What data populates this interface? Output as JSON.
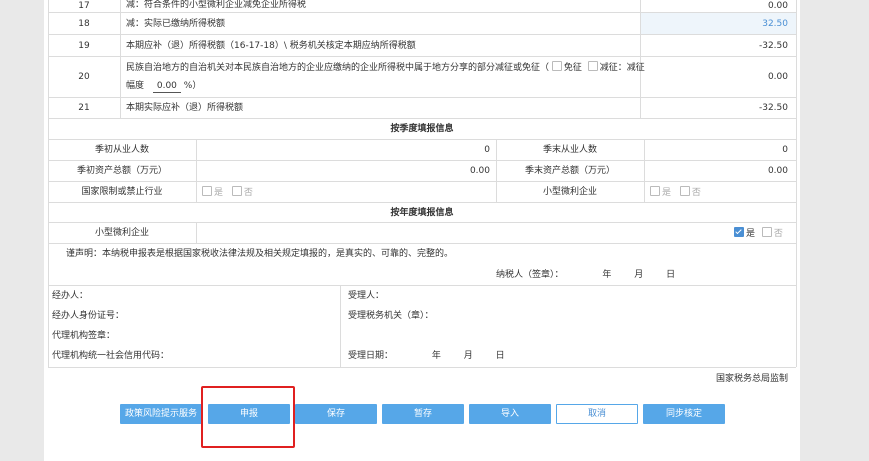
{
  "rows": [
    {
      "no": "17",
      "label": "减：符合条件的小型微利企业减免企业所得税",
      "value": "0.00"
    },
    {
      "no": "18",
      "label": "减：实际已缴纳所得税额",
      "value": "32.50"
    },
    {
      "no": "19",
      "label": "本期应补（退）所得税额（16-17-18）\\ 税务机关核定本期应纳所得税额",
      "value": "-32.50"
    },
    {
      "no": "20",
      "label_line1": "民族自治地方的自治机关对本民族自治地方的企业应缴纳的企业所得税中属于地方分享的部分减征或免征（",
      "exempt": "免征",
      "reduce": "减征：减征",
      "label_line2_prefix": "幅度",
      "rate": "0.00",
      "rate_suffix": "%）",
      "value": "0.00"
    },
    {
      "no": "21",
      "label": "本期实际应补（退）所得税额",
      "value": "-32.50"
    }
  ],
  "quarterly": {
    "header": "按季度填报信息",
    "start_employees_label": "季初从业人数",
    "start_employees_value": "0",
    "end_employees_label": "季末从业人数",
    "end_employees_value": "0",
    "start_assets_label": "季初资产总额（万元）",
    "start_assets_value": "0.00",
    "end_assets_label": "季末资产总额（万元）",
    "end_assets_value": "0.00",
    "restricted_label": "国家限制或禁止行业",
    "small_micro_label": "小型微利企业",
    "yes": "是",
    "no": "否"
  },
  "annual": {
    "header": "按年度填报信息",
    "small_micro_label": "小型微利企业",
    "yes": "是",
    "no": "否"
  },
  "declaration": "谨声明：本纳税申报表是根据国家税收法律法规及相关规定填报的，是真实的、可靠的、完整的。",
  "signature": {
    "taxpayer": "纳税人（签章）：",
    "year": "年",
    "month": "月",
    "day": "日"
  },
  "agents": {
    "handler": "经办人：",
    "handler_id": "经办人身份证号：",
    "agency_seal": "代理机构签章：",
    "agency_credit_code": "代理机构统一社会信用代码：",
    "receiver": "受理人：",
    "receiving_office": "受理税务机关（章）：",
    "receive_date": "受理日期：",
    "year": "年",
    "month": "月",
    "day": "日"
  },
  "footer_note": "国家税务总局监制",
  "buttons": {
    "policy_risk": "政策风险提示服务",
    "submit": "申报",
    "save": "保存",
    "temp_save": "暂存",
    "import": "导入",
    "cancel": "取消",
    "sync": "同步核定"
  },
  "colors": {
    "primary": "#56a7e8",
    "highlight_box": "#e02020",
    "highlight_cell": "#eef5fb"
  }
}
